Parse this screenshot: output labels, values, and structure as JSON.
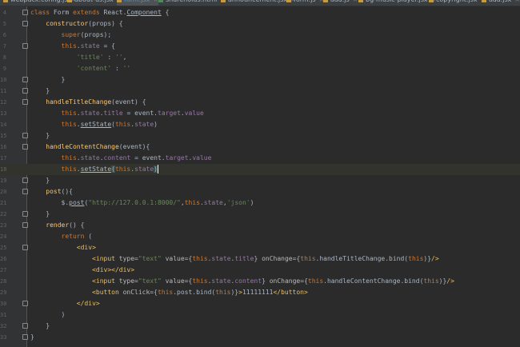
{
  "tabs": [
    {
      "label": "webpack.config.js",
      "icon_color": "#c59b3e",
      "active": false
    },
    {
      "label": "about-us.jsx",
      "icon_color": "#c59b3e",
      "active": false
    },
    {
      "label": "form.jsx",
      "icon_color": "#c59b3e",
      "active": true
    },
    {
      "label": "shareholds.html",
      "icon_color": "#4f8b5a",
      "active": false
    },
    {
      "label": "announcement.jsx",
      "icon_color": "#c59b3e",
      "active": false
    },
    {
      "label": "form.js",
      "icon_color": "#c59b3e",
      "active": false
    },
    {
      "label": "aaa.js",
      "icon_color": "#c59b3e",
      "active": false
    },
    {
      "label": "bg-music-player.jsx",
      "icon_color": "#c59b3e",
      "active": false
    },
    {
      "label": "copyright.jsx",
      "icon_color": "#c59b3e",
      "active": false
    },
    {
      "label": "aaa.jsx",
      "icon_color": "#c59b3e",
      "active": false
    }
  ],
  "tab_close_glyph": "×",
  "editor": {
    "current_line": 18,
    "lines": [
      {
        "n": "4",
        "fold": true,
        "tokens": [
          [
            "kw",
            "class "
          ],
          [
            "t",
            "Form "
          ],
          [
            "kw",
            "extends "
          ],
          [
            "t",
            "React."
          ],
          [
            "u",
            "Component"
          ],
          [
            "t",
            " {"
          ]
        ]
      },
      {
        "n": "5",
        "fold": true,
        "tokens": [
          [
            "ind",
            "    "
          ],
          [
            "mth",
            "constructor"
          ],
          [
            "t",
            "(props) {"
          ]
        ]
      },
      {
        "n": "6",
        "fold": false,
        "tokens": [
          [
            "ind",
            "        "
          ],
          [
            "kw",
            "super"
          ],
          [
            "t",
            "(props);"
          ]
        ]
      },
      {
        "n": "7",
        "fold": true,
        "tokens": [
          [
            "ind",
            "        "
          ],
          [
            "kw",
            "this"
          ],
          [
            "t",
            "."
          ],
          [
            "fld",
            "state"
          ],
          [
            "t",
            " = {"
          ]
        ]
      },
      {
        "n": "8",
        "fold": false,
        "tokens": [
          [
            "ind",
            "            "
          ],
          [
            "str",
            "'title'"
          ],
          [
            "t",
            " : "
          ],
          [
            "str",
            "''"
          ],
          [
            "t",
            ","
          ]
        ]
      },
      {
        "n": "9",
        "fold": false,
        "tokens": [
          [
            "ind",
            "            "
          ],
          [
            "str",
            "'content'"
          ],
          [
            "t",
            " : "
          ],
          [
            "str",
            "''"
          ]
        ]
      },
      {
        "n": "10",
        "fold": true,
        "tokens": [
          [
            "ind",
            "        "
          ],
          [
            "t",
            "}"
          ]
        ]
      },
      {
        "n": "11",
        "fold": true,
        "tokens": [
          [
            "ind",
            "    "
          ],
          [
            "t",
            "}"
          ]
        ]
      },
      {
        "n": "12",
        "fold": true,
        "tokens": [
          [
            "ind",
            "    "
          ],
          [
            "mth",
            "handleTitleChange"
          ],
          [
            "t",
            "(event) {"
          ]
        ]
      },
      {
        "n": "13",
        "fold": false,
        "tokens": [
          [
            "ind",
            "        "
          ],
          [
            "kw",
            "this"
          ],
          [
            "t",
            "."
          ],
          [
            "fld",
            "state"
          ],
          [
            "t",
            "."
          ],
          [
            "fld",
            "title"
          ],
          [
            "t",
            " = event."
          ],
          [
            "fld",
            "target"
          ],
          [
            "t",
            "."
          ],
          [
            "fld",
            "value"
          ]
        ]
      },
      {
        "n": "14",
        "fold": false,
        "tokens": [
          [
            "ind",
            "        "
          ],
          [
            "kw",
            "this"
          ],
          [
            "t",
            "."
          ],
          [
            "u",
            "setState"
          ],
          [
            "t",
            "("
          ],
          [
            "kw",
            "this"
          ],
          [
            "t",
            "."
          ],
          [
            "fld",
            "state"
          ],
          [
            "t",
            ")"
          ]
        ]
      },
      {
        "n": "15",
        "fold": true,
        "tokens": [
          [
            "ind",
            "    "
          ],
          [
            "t",
            "}"
          ]
        ]
      },
      {
        "n": "16",
        "fold": true,
        "tokens": [
          [
            "ind",
            "    "
          ],
          [
            "mth",
            "handleContentChange"
          ],
          [
            "t",
            "(event){"
          ]
        ]
      },
      {
        "n": "17",
        "fold": false,
        "tokens": [
          [
            "ind",
            "        "
          ],
          [
            "kw",
            "this"
          ],
          [
            "t",
            "."
          ],
          [
            "fld",
            "state"
          ],
          [
            "t",
            "."
          ],
          [
            "fld",
            "content"
          ],
          [
            "t",
            " = event."
          ],
          [
            "fld",
            "target"
          ],
          [
            "t",
            "."
          ],
          [
            "fld",
            "value"
          ]
        ]
      },
      {
        "n": "18",
        "fold": false,
        "tokens": [
          [
            "ind",
            "        "
          ],
          [
            "kw",
            "this"
          ],
          [
            "t",
            "."
          ],
          [
            "u",
            "setState"
          ],
          [
            "bhl",
            "("
          ],
          [
            "kw",
            "this"
          ],
          [
            "t",
            "."
          ],
          [
            "fld",
            "state"
          ],
          [
            "bhl",
            ")"
          ],
          [
            "caret",
            ""
          ]
        ]
      },
      {
        "n": "19",
        "fold": true,
        "tokens": [
          [
            "ind",
            "    "
          ],
          [
            "t",
            "}"
          ]
        ]
      },
      {
        "n": "20",
        "fold": true,
        "tokens": [
          [
            "ind",
            "    "
          ],
          [
            "mth",
            "post"
          ],
          [
            "t",
            "(){"
          ]
        ]
      },
      {
        "n": "21",
        "fold": false,
        "tokens": [
          [
            "ind",
            "        "
          ],
          [
            "t",
            "$."
          ],
          [
            "u",
            "post"
          ],
          [
            "t",
            "("
          ],
          [
            "str",
            "\"http://127.0.0.1:8000/\""
          ],
          [
            "t",
            ","
          ],
          [
            "kw",
            "this"
          ],
          [
            "t",
            "."
          ],
          [
            "fld",
            "state"
          ],
          [
            "t",
            ","
          ],
          [
            "str",
            "'json'"
          ],
          [
            "t",
            ")"
          ]
        ]
      },
      {
        "n": "22",
        "fold": true,
        "tokens": [
          [
            "ind",
            "    "
          ],
          [
            "t",
            "}"
          ]
        ]
      },
      {
        "n": "23",
        "fold": true,
        "tokens": [
          [
            "ind",
            "    "
          ],
          [
            "mth",
            "render"
          ],
          [
            "t",
            "() {"
          ]
        ]
      },
      {
        "n": "24",
        "fold": false,
        "tokens": [
          [
            "ind",
            "        "
          ],
          [
            "kw",
            "return"
          ],
          [
            "t",
            " ("
          ]
        ]
      },
      {
        "n": "25",
        "fold": true,
        "tokens": [
          [
            "ind",
            "            "
          ],
          [
            "tag",
            "<div>"
          ]
        ]
      },
      {
        "n": "26",
        "fold": false,
        "tokens": [
          [
            "ind",
            "                "
          ],
          [
            "tag",
            "<input "
          ],
          [
            "attr",
            "type="
          ],
          [
            "str",
            "\"text\" "
          ],
          [
            "attr",
            "value="
          ],
          [
            "t",
            "{"
          ],
          [
            "kw",
            "this"
          ],
          [
            "t",
            "."
          ],
          [
            "fld",
            "state"
          ],
          [
            "t",
            "."
          ],
          [
            "fld",
            "title"
          ],
          [
            "t",
            "} "
          ],
          [
            "attr",
            "onChange="
          ],
          [
            "t",
            "{"
          ],
          [
            "kw",
            "this"
          ],
          [
            "t",
            ".handleTitleChange.bind("
          ],
          [
            "kw",
            "this"
          ],
          [
            "t",
            ")}"
          ],
          [
            "tag",
            "/>"
          ]
        ]
      },
      {
        "n": "27",
        "fold": false,
        "tokens": [
          [
            "ind",
            "                "
          ],
          [
            "tag",
            "<div></div>"
          ]
        ]
      },
      {
        "n": "28",
        "fold": false,
        "tokens": [
          [
            "ind",
            "                "
          ],
          [
            "tag",
            "<input "
          ],
          [
            "attr",
            "type="
          ],
          [
            "str",
            "\"text\" "
          ],
          [
            "attr",
            "value="
          ],
          [
            "t",
            "{"
          ],
          [
            "kw",
            "this"
          ],
          [
            "t",
            "."
          ],
          [
            "fld",
            "state"
          ],
          [
            "t",
            "."
          ],
          [
            "fld",
            "content"
          ],
          [
            "t",
            "} "
          ],
          [
            "attr",
            "onChange="
          ],
          [
            "t",
            "{"
          ],
          [
            "kw",
            "this"
          ],
          [
            "t",
            ".handleContentChange.bind("
          ],
          [
            "kw",
            "this"
          ],
          [
            "t",
            ")}"
          ],
          [
            "tag",
            "/>"
          ]
        ]
      },
      {
        "n": "29",
        "fold": false,
        "tokens": [
          [
            "ind",
            "                "
          ],
          [
            "tag",
            "<button "
          ],
          [
            "attr",
            "onClick="
          ],
          [
            "t",
            "{"
          ],
          [
            "kw",
            "this"
          ],
          [
            "t",
            ".post.bind("
          ],
          [
            "kw",
            "this"
          ],
          [
            "t",
            ")}"
          ],
          [
            "tag",
            ">"
          ],
          [
            "t",
            "11111111"
          ],
          [
            "tag",
            "</button>"
          ]
        ]
      },
      {
        "n": "30",
        "fold": true,
        "tokens": [
          [
            "ind",
            "            "
          ],
          [
            "tag",
            "</div>"
          ]
        ]
      },
      {
        "n": "31",
        "fold": false,
        "tokens": [
          [
            "ind",
            "        "
          ],
          [
            "t",
            ")"
          ]
        ]
      },
      {
        "n": "32",
        "fold": true,
        "tokens": [
          [
            "ind",
            "    "
          ],
          [
            "t",
            "}"
          ]
        ]
      },
      {
        "n": "33",
        "fold": true,
        "tokens": [
          [
            "t",
            "}"
          ]
        ]
      }
    ]
  }
}
